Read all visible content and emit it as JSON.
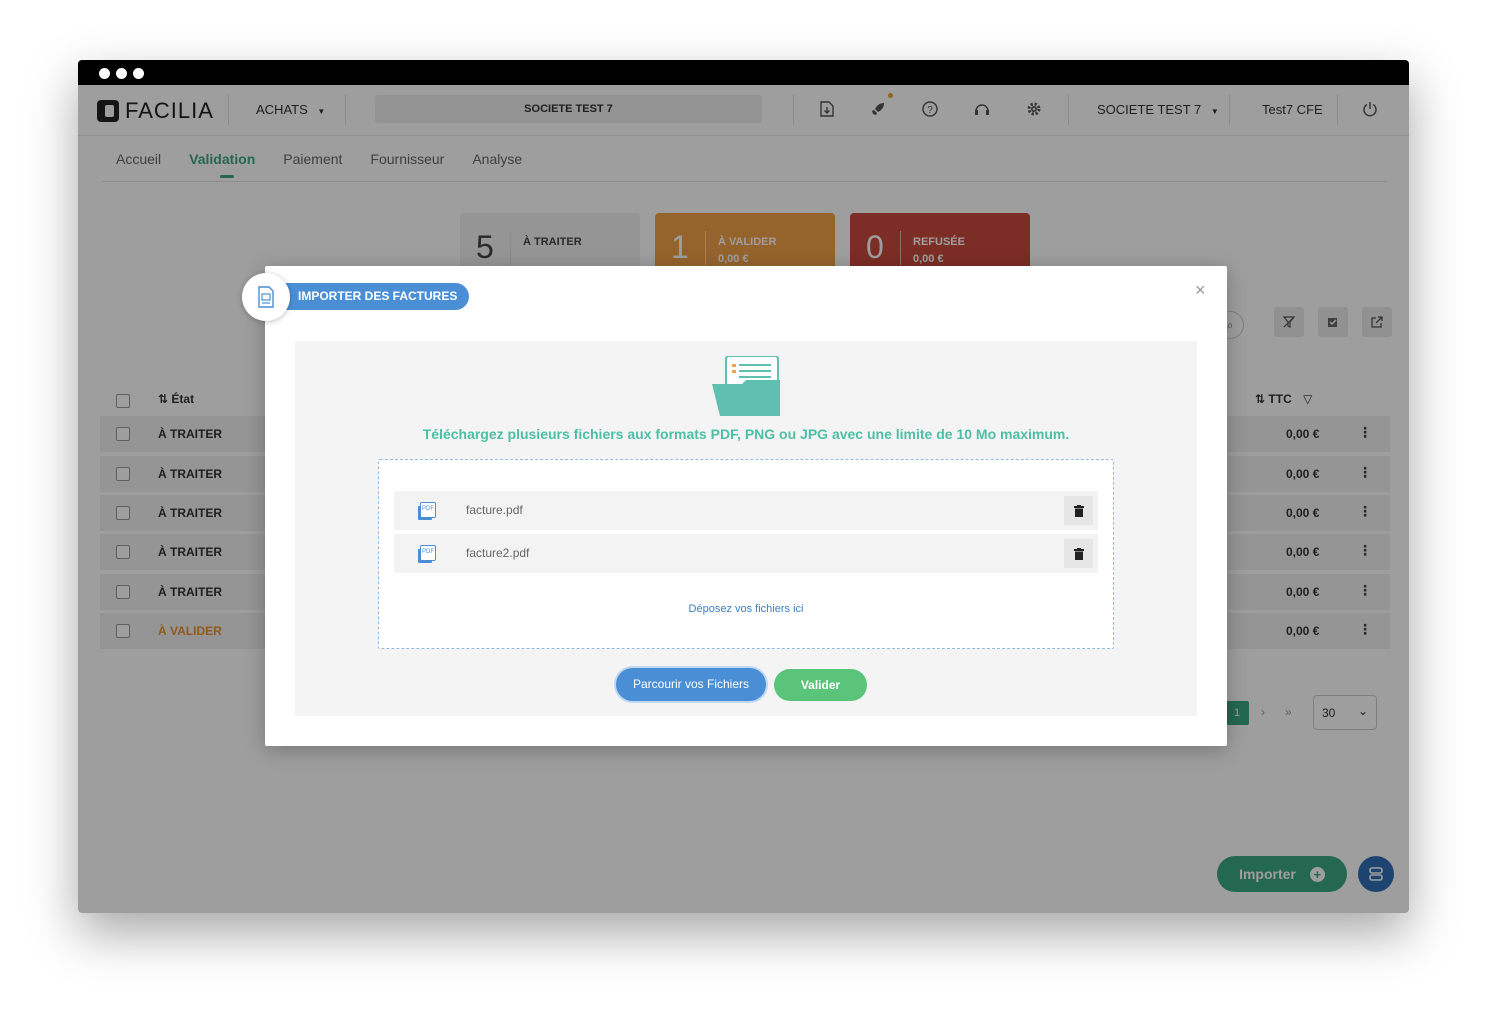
{
  "header": {
    "logo_text": "FACILIA",
    "module_menu": "ACHATS",
    "company_display": "SOCIETE TEST 7",
    "company_selector": "SOCIETE TEST 7",
    "user_name": "Test7 CFE",
    "icons": [
      "download-doc-icon",
      "rocket-icon",
      "help-icon",
      "support-icon",
      "gear-icon",
      "power-icon"
    ]
  },
  "tabs": [
    {
      "label": "Accueil",
      "active": false
    },
    {
      "label": "Validation",
      "active": true
    },
    {
      "label": "Paiement",
      "active": false
    },
    {
      "label": "Fournisseur",
      "active": false
    },
    {
      "label": "Analyse",
      "active": false
    }
  ],
  "stats": [
    {
      "count": "5",
      "label": "À TRAITER",
      "amount": "",
      "color": "#f1f1f1"
    },
    {
      "count": "1",
      "label": "À VALIDER",
      "amount": "0,00 €",
      "color": "#f0a24a"
    },
    {
      "count": "0",
      "label": "REFUSÉE",
      "amount": "0,00 €",
      "color": "#c94a3c"
    }
  ],
  "table": {
    "col_state": "État",
    "col_ttc": "TTC",
    "rows": [
      {
        "state": "À TRAITER",
        "amount": "0,00 €"
      },
      {
        "state": "À TRAITER",
        "amount": "0,00 €"
      },
      {
        "state": "À TRAITER",
        "amount": "0,00 €"
      },
      {
        "state": "À TRAITER",
        "amount": "0,00 €"
      },
      {
        "state": "À TRAITER",
        "amount": "0,00 €"
      },
      {
        "state": "À VALIDER",
        "amount": "0,00 €"
      }
    ]
  },
  "pagination": {
    "current_page": "1",
    "next": "›",
    "last": "»",
    "per_page": "30"
  },
  "fab": {
    "import_label": "Importer"
  },
  "modal": {
    "title": "IMPORTER DES FACTURES",
    "info": "Téléchargez plusieurs fichiers aux formats PDF, PNG ou JPG avec une limite de 10 Mo maximum.",
    "files": [
      {
        "name": "facture.pdf"
      },
      {
        "name": "facture2.pdf"
      }
    ],
    "drop_text": "Déposez vos fichiers ici",
    "browse_label": "Parcourir vos Fichiers",
    "validate_label": "Valider",
    "close_glyph": "×"
  },
  "colors": {
    "accent_green": "#3aa883",
    "accent_blue": "#4a8fd6",
    "validate_green": "#5ac47a",
    "info_teal": "#4cbfa6"
  }
}
